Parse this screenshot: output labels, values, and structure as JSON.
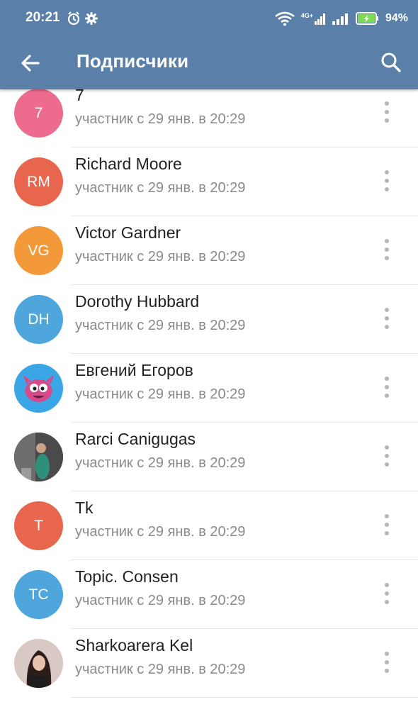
{
  "status_bar": {
    "time": "20:21",
    "network": "4G+",
    "battery": "94%"
  },
  "app_bar": {
    "title": "Подписчики"
  },
  "members": [
    {
      "name": "7",
      "initials": "7",
      "subtitle": "участник с 29 янв. в 20:29",
      "color": "#ec6b8f"
    },
    {
      "name": "Richard Moore",
      "initials": "RM",
      "subtitle": "участник с 29 янв. в 20:29",
      "color": "#e8664d"
    },
    {
      "name": "Victor Gardner",
      "initials": "VG",
      "subtitle": "участник с 29 янв. в 20:29",
      "color": "#f4993a"
    },
    {
      "name": "Dorothy Hubbard",
      "initials": "DH",
      "subtitle": "участник с 29 янв. в 20:29",
      "color": "#4fa6dc"
    },
    {
      "name": "Евгений Егоров",
      "initials": "",
      "subtitle": "участник с 29 янв. в 20:29",
      "color": "#3aa6e6"
    },
    {
      "name": "Rarci Canigugas",
      "initials": "",
      "subtitle": "участник с 29 янв. в 20:29",
      "color": "#3b3b3b"
    },
    {
      "name": "Tk",
      "initials": "T",
      "subtitle": "участник с 29 янв. в 20:29",
      "color": "#e8664d"
    },
    {
      "name": "Topic. Consen",
      "initials": "TC",
      "subtitle": "участник с 29 янв. в 20:29",
      "color": "#4fa6dc"
    },
    {
      "name": "Sharkoarera Kel",
      "initials": "",
      "subtitle": "участник с 29 янв. в 20:29",
      "color": "#d9c9c5"
    }
  ]
}
